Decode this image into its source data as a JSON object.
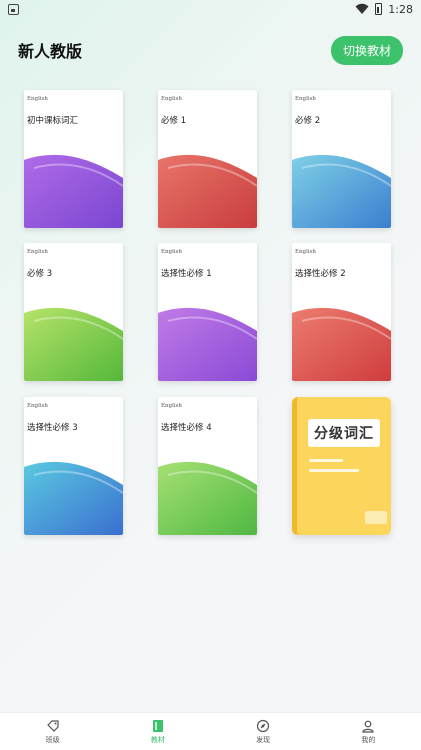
{
  "status_bar": {
    "time": "1:28"
  },
  "header": {
    "title": "新人教版",
    "switch_button_label": "切换教材"
  },
  "books": [
    {
      "en_label": "English",
      "title": "初中课标词汇",
      "colors": [
        "#b06be8",
        "#7a46d1"
      ]
    },
    {
      "en_label": "English",
      "title": "必修 1",
      "colors": [
        "#e8756a",
        "#c93d3d"
      ]
    },
    {
      "en_label": "English",
      "title": "必修 2",
      "colors": [
        "#7fd0e6",
        "#3a7fd0"
      ]
    },
    {
      "en_label": "English",
      "title": "必修 3",
      "colors": [
        "#b7e36a",
        "#54b83a"
      ]
    },
    {
      "en_label": "English",
      "title": "选择性必修 1",
      "colors": [
        "#c17be6",
        "#8a4ad6"
      ]
    },
    {
      "en_label": "English",
      "title": "选择性必修 2",
      "colors": [
        "#ec7c70",
        "#cf3d3d"
      ]
    },
    {
      "en_label": "English",
      "title": "选择性必修 3",
      "colors": [
        "#5bc9e0",
        "#3a6fd0"
      ]
    },
    {
      "en_label": "English",
      "title": "选择性必修 4",
      "colors": [
        "#a6e074",
        "#4fb842"
      ]
    }
  ],
  "graded_book": {
    "label": "分级词汇",
    "color": "#fcd55c"
  },
  "tabbar": {
    "tabs": [
      {
        "label": "班级",
        "icon": "tag-icon"
      },
      {
        "label": "教材",
        "icon": "book-icon",
        "active": true
      },
      {
        "label": "发现",
        "icon": "compass-icon"
      },
      {
        "label": "我的",
        "icon": "user-icon"
      }
    ],
    "accent": "#3bc26a"
  }
}
